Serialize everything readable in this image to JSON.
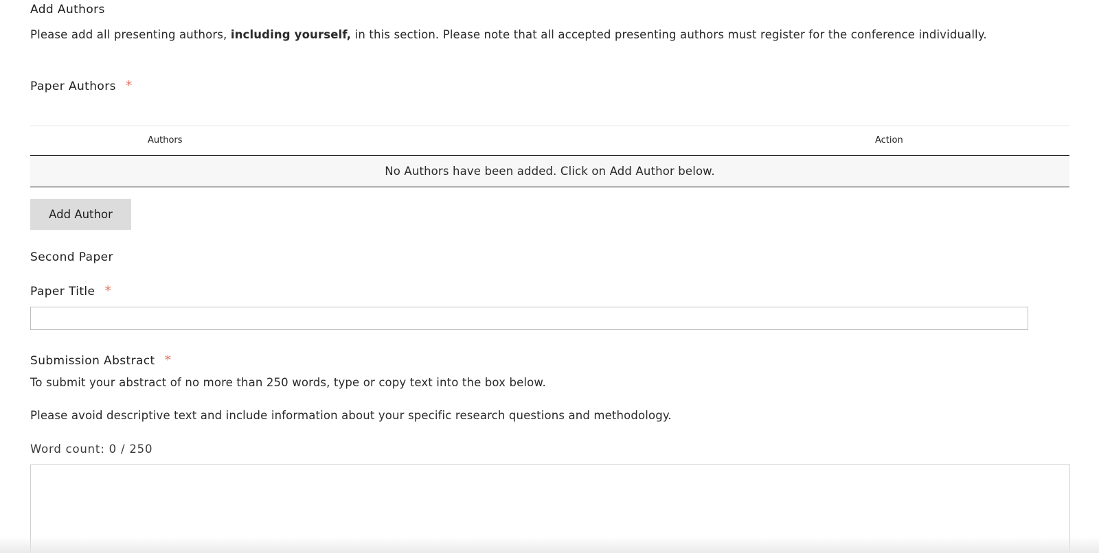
{
  "add_authors": {
    "title": "Add Authors",
    "intro_before": "Please add all presenting authors, ",
    "intro_bold": "including yourself,",
    "intro_after": " in this section. Please note that all accepted presenting authors must register for the conference individually."
  },
  "paper_authors": {
    "label": "Paper Authors",
    "required_mark": "*",
    "table": {
      "columns": [
        "Authors",
        "Action"
      ],
      "empty_message": "No Authors have been added. Click on Add Author below."
    },
    "add_button_label": "Add Author"
  },
  "second_paper": {
    "title": "Second Paper"
  },
  "paper_title": {
    "label": "Paper Title",
    "required_mark": "*",
    "value": ""
  },
  "submission_abstract": {
    "label": "Submission Abstract",
    "required_mark": "*",
    "help_1": "To submit your abstract of no more than 250 words, type or copy text into the box below.",
    "help_2": "Please avoid descriptive text and include information about your specific research questions and methodology.",
    "word_count": "Word count: 0 / 250",
    "value": ""
  },
  "colors": {
    "required": "#e8705f",
    "button_bg": "#dcdcdc",
    "empty_row_bg": "#f7f7f7"
  }
}
